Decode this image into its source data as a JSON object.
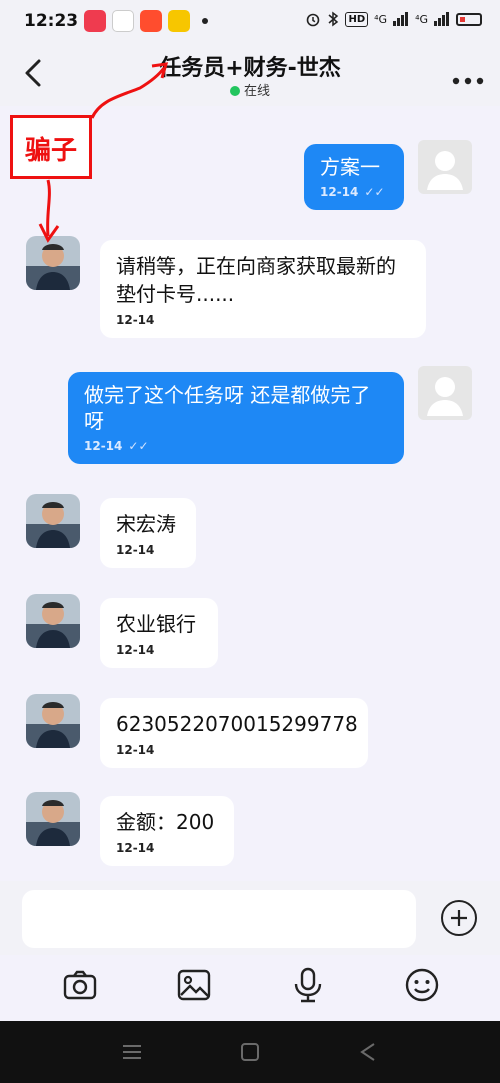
{
  "status_bar": {
    "time": "12:23",
    "hd_badge": "HD",
    "network_1": "⁴G",
    "network_2": "⁴G"
  },
  "header": {
    "title": "任务员+财务-世杰",
    "status": "在线"
  },
  "annotation": {
    "label": "骗子",
    "color": "#e11111"
  },
  "messages": [
    {
      "side": "out",
      "text": "方案一",
      "time": "12-14",
      "read": true
    },
    {
      "side": "in",
      "text": "请稍等，正在向商家获取最新的垫付卡号......",
      "time": "12-14"
    },
    {
      "side": "out",
      "text": "做完了这个任务呀 还是都做完了呀",
      "time": "12-14",
      "read": true
    },
    {
      "side": "in",
      "text": "宋宏涛",
      "time": "12-14"
    },
    {
      "side": "in",
      "text": "农业银行",
      "time": "12-14"
    },
    {
      "side": "in",
      "text": "6230522070015299778",
      "time": "12-14"
    },
    {
      "side": "in",
      "text": "金额：200",
      "time": "12-14"
    }
  ],
  "icons": {
    "back": "chevron-left-icon",
    "more": "more-dots-icon",
    "camera": "camera-icon",
    "gallery": "image-icon",
    "mic": "microphone-icon",
    "emoji": "emoji-icon",
    "plus": "plus-circle-icon"
  },
  "colors": {
    "outgoing_bubble": "#1e88f5",
    "incoming_bubble": "#ffffff",
    "online_dot": "#22c55e"
  }
}
